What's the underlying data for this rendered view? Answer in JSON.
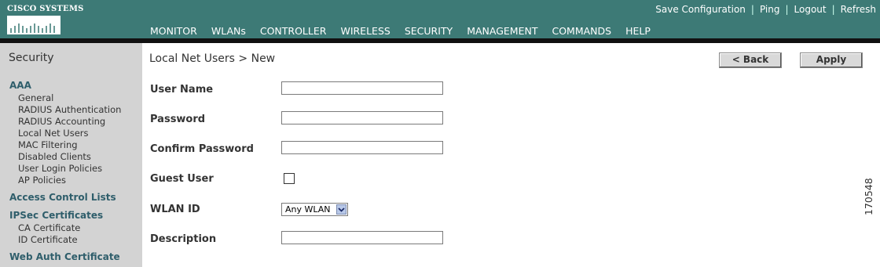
{
  "header": {
    "logo_text": "CISCO SYSTEMS",
    "utility_links": [
      "Save Configuration",
      "Ping",
      "Logout",
      "Refresh"
    ],
    "nav": [
      "MONITOR",
      "WLANs",
      "CONTROLLER",
      "WIRELESS",
      "SECURITY",
      "MANAGEMENT",
      "COMMANDS",
      "HELP"
    ],
    "active_nav": "SECURITY",
    "accent_color": "#f0a020",
    "bar_color": "#3d7a76"
  },
  "sidebar": {
    "title": "Security",
    "groups": [
      {
        "label": "AAA",
        "items": [
          "General",
          "RADIUS Authentication",
          "RADIUS Accounting",
          "Local Net Users",
          "MAC Filtering",
          "Disabled Clients",
          "User Login Policies",
          "AP Policies"
        ]
      },
      {
        "label": "Access Control Lists",
        "items": []
      },
      {
        "label": "IPSec Certificates",
        "items": [
          "CA Certificate",
          "ID Certificate"
        ]
      },
      {
        "label": "Web Auth Certificate",
        "items": []
      }
    ]
  },
  "main": {
    "title": "Local Net Users > New",
    "back_button": "< Back",
    "apply_button": "Apply",
    "fields": {
      "user_name": {
        "label": "User Name",
        "value": ""
      },
      "password": {
        "label": "Password",
        "value": ""
      },
      "confirm_password": {
        "label": "Confirm Password",
        "value": ""
      },
      "guest_user": {
        "label": "Guest User",
        "checked": false
      },
      "wlan_id": {
        "label": "WLAN ID",
        "selected": "Any WLAN"
      },
      "description": {
        "label": "Description",
        "value": ""
      }
    }
  },
  "figure_id": "170548"
}
